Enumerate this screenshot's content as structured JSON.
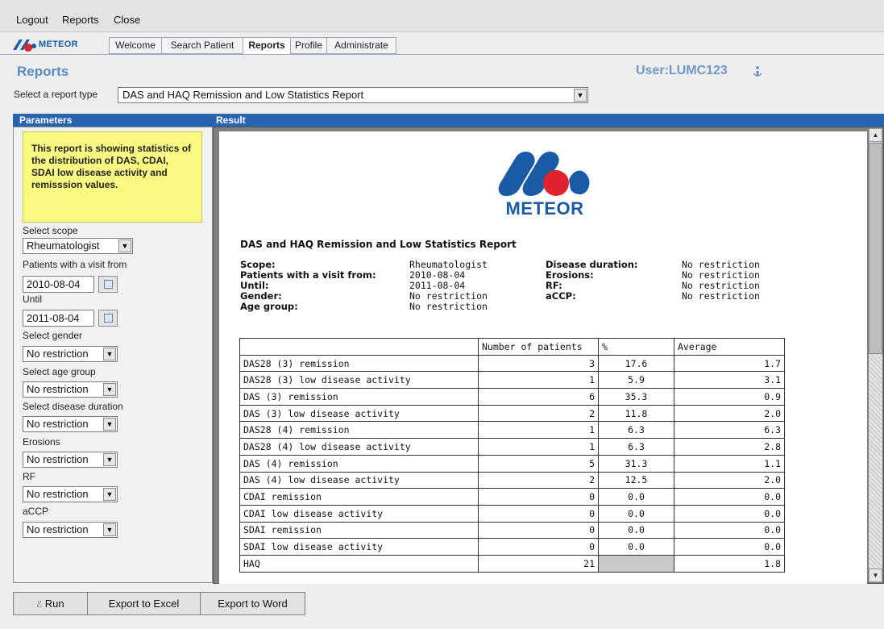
{
  "menu": {
    "items": [
      "Logout",
      "Reports",
      "Close"
    ]
  },
  "logo": {
    "text": "METEOR"
  },
  "nav": {
    "tabs": [
      "Welcome",
      "Search Patient",
      "Reports",
      "Profile",
      "Administrate"
    ],
    "active": "Reports"
  },
  "page": {
    "title": "Reports",
    "user": "User:LUMC123"
  },
  "report_type": {
    "label": "Select a report type",
    "value": "DAS and HAQ Remission and Low Statistics Report"
  },
  "parameters": {
    "header": "Parameters",
    "description": "This report is showing statistics of the distribution of DAS, CDAI, SDAI low disease activity and remisssion values.",
    "scope": {
      "label": "Select scope",
      "value": "Rheumatologist"
    },
    "visit_from": {
      "label": "Patients with a visit from",
      "value": "2010-08-04"
    },
    "until": {
      "label": "Until",
      "value": "2011-08-04"
    },
    "gender": {
      "label": "Select gender",
      "value": "No restriction"
    },
    "age_group": {
      "label": "Select age group",
      "value": "No restriction"
    },
    "disease_duration": {
      "label": "Select disease duration",
      "value": "No restriction"
    },
    "erosions": {
      "label": "Erosions",
      "value": "No restriction"
    },
    "rf": {
      "label": "RF",
      "value": "No restriction"
    },
    "accp": {
      "label": "aCCP",
      "value": "No restriction"
    }
  },
  "result": {
    "header": "Result",
    "logo_text": "METEOR",
    "report_title": "DAS and HAQ Remission and Low Statistics Report",
    "meta_left": [
      {
        "key": "Scope:",
        "value": "Rheumatologist"
      },
      {
        "key": "Patients with a visit from:",
        "value": "2010-08-04"
      },
      {
        "key": "Until:",
        "value": "2011-08-04"
      },
      {
        "key": "Gender:",
        "value": "No restriction"
      },
      {
        "key": "Age group:",
        "value": "No restriction"
      }
    ],
    "meta_right": [
      {
        "key": "Disease duration:",
        "value": "No restriction"
      },
      {
        "key": "Erosions:",
        "value": "No restriction"
      },
      {
        "key": "RF:",
        "value": "No restriction"
      },
      {
        "key": "aCCP:",
        "value": "No restriction"
      }
    ],
    "table": {
      "headers": [
        "",
        "Number of patients",
        "%",
        "Average"
      ],
      "rows": [
        [
          "DAS28 (3) remission",
          "3",
          "17.6",
          "1.7"
        ],
        [
          "DAS28 (3) low disease activity",
          "1",
          "5.9",
          "3.1"
        ],
        [
          "DAS (3) remission",
          "6",
          "35.3",
          "0.9"
        ],
        [
          "DAS (3) low disease activity",
          "2",
          "11.8",
          "2.0"
        ],
        [
          "DAS28 (4) remission",
          "1",
          "6.3",
          "6.3"
        ],
        [
          "DAS28 (4) low disease activity",
          "1",
          "6.3",
          "2.8"
        ],
        [
          "DAS (4) remission",
          "5",
          "31.3",
          "1.1"
        ],
        [
          "DAS (4) low disease activity",
          "2",
          "12.5",
          "2.0"
        ],
        [
          "CDAI remission",
          "0",
          "0.0",
          "0.0"
        ],
        [
          "CDAI low disease activity",
          "0",
          "0.0",
          "0.0"
        ],
        [
          "SDAI remission",
          "0",
          "0.0",
          "0.0"
        ],
        [
          "SDAI low disease activity",
          "0",
          "0.0",
          "0.0"
        ],
        [
          "HAQ",
          "21",
          "",
          "1.8"
        ]
      ]
    }
  },
  "buttons": {
    "run": "Run",
    "export_excel": "Export to Excel",
    "export_word": "Export to Word"
  },
  "colors": {
    "header_blue": "#2863b0",
    "logo_blue": "#1a5ba6",
    "logo_red": "#e0232e",
    "desc_yellow": "#fafa82"
  }
}
